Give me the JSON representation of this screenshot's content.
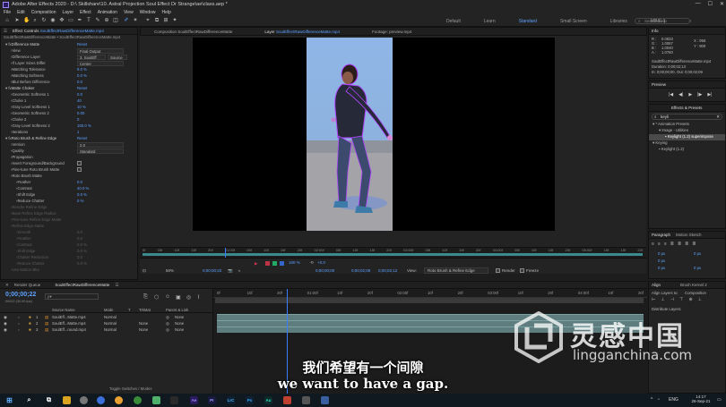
{
  "window": {
    "title": "Adobe After Effects 2020 - D:\\ Skillshare\\10. Astral Projection Soul Effect Dr Strange\\ae\\class.aep *",
    "controls": [
      "—",
      "☐",
      "✕"
    ]
  },
  "menu": [
    "File",
    "Edit",
    "Composition",
    "Layer",
    "Effect",
    "Animation",
    "View",
    "Window",
    "Help"
  ],
  "workspaces": {
    "items": [
      "Default",
      "Learn",
      "Standard",
      "Small Screen",
      "Libraries",
      "MINE 1"
    ],
    "active_index": 2,
    "overflow": "»"
  },
  "search_help": {
    "placeholder": "Search Help"
  },
  "effect_controls": {
    "tab_label": "Effect Controls",
    "tab_link": "SoulEffectRawDifferenceMatte.mp4",
    "layer_path": "SoulEffectRawDifferenceMatte • SoulEffectRawDifferenceMatte.mp4",
    "rows": [
      {
        "label": "Difference Matte",
        "value": "Reset",
        "indent": 0
      },
      {
        "label": "View",
        "value": "Final Output",
        "indent": 1,
        "select": true
      },
      {
        "label": "Difference Layer",
        "value": "3. SoulEff",
        "value2": "Source",
        "indent": 1,
        "select": true
      },
      {
        "label": "If Layer Sizes Differ",
        "value": "Center",
        "indent": 1,
        "select": true
      },
      {
        "label": "Matching Tolerance",
        "value": "9.0 %",
        "indent": 1
      },
      {
        "label": "Matching Softness",
        "value": "0.0 %",
        "indent": 1
      },
      {
        "label": "Blur Before Difference",
        "value": "0.0",
        "indent": 1
      },
      {
        "label": "Matte Choker",
        "value": "Reset",
        "indent": 0
      },
      {
        "label": "Geometric Softness 1",
        "value": "0.0",
        "indent": 1
      },
      {
        "label": "Choke 1",
        "value": "40",
        "indent": 1
      },
      {
        "label": "Gray Level Softness 1",
        "value": "10 %",
        "indent": 1
      },
      {
        "label": "Geometric Softness 2",
        "value": "0.00",
        "indent": 1
      },
      {
        "label": "Choke 2",
        "value": "0",
        "indent": 1
      },
      {
        "label": "Gray Level Softness 2",
        "value": "100.0 %",
        "indent": 1
      },
      {
        "label": "Iterations",
        "value": "1",
        "indent": 1
      },
      {
        "label": "Roto Brush & Refine Edge",
        "value": "Reset",
        "indent": 0
      },
      {
        "label": "Version",
        "value": "2.0",
        "indent": 1,
        "select": true
      },
      {
        "label": "Quality",
        "value": "Standard",
        "indent": 1,
        "select": true
      },
      {
        "label": "Propagation",
        "value": "",
        "indent": 1
      },
      {
        "label": "Invert Foreground/Background",
        "value": "",
        "indent": 1,
        "checkbox": true
      },
      {
        "label": "Fine-tune Roto Brush Matte",
        "value": "",
        "indent": 1,
        "checkbox": true
      },
      {
        "label": "Roto Brush Matte",
        "value": "",
        "indent": 1
      },
      {
        "label": "Feather",
        "value": "0.0",
        "indent": 2
      },
      {
        "label": "Contrast",
        "value": "40.0 %",
        "indent": 2
      },
      {
        "label": "Shift Edge",
        "value": "0.0 %",
        "indent": 2
      },
      {
        "label": "Reduce Chatter",
        "value": "0 %",
        "indent": 2
      },
      {
        "label": "Render Refine Edge",
        "value": "",
        "indent": 1,
        "dim": true
      },
      {
        "label": "Base Refine Edge Radius",
        "value": "",
        "indent": 1,
        "dim": true
      },
      {
        "label": "Fine-tune Refine Edge Matte",
        "value": "",
        "indent": 1,
        "dim": true
      },
      {
        "label": "Refine Edge Matte",
        "value": "",
        "indent": 1,
        "dim": true
      },
      {
        "label": "Smooth",
        "value": "0.0",
        "indent": 2,
        "dim": true
      },
      {
        "label": "Feather",
        "value": "0.0",
        "indent": 2,
        "dim": true
      },
      {
        "label": "Contrast",
        "value": "0.0 %",
        "indent": 2,
        "dim": true
      },
      {
        "label": "Shift Edge",
        "value": "0.0 %",
        "indent": 2,
        "dim": true
      },
      {
        "label": "Chatter Reduction",
        "value": "0.0",
        "indent": 2,
        "dim": true
      },
      {
        "label": "Reduce Chatter",
        "value": "0.0 %",
        "indent": 2,
        "dim": true
      },
      {
        "label": "Use Motion Blur",
        "value": "",
        "indent": 1,
        "dim": true
      }
    ]
  },
  "composition": {
    "tab_label": "Composition",
    "tab_link": "SoulEffectRawDifferenceMatte",
    "layer_tab": "Layer",
    "layer_link": "SoulEffectRawDifferenceMatte.mp4",
    "footage_tab": "Footage: preview.mp4"
  },
  "mini_ruler": {
    "ticks": [
      "0f",
      "05f",
      "10f",
      "15f",
      "20f",
      "01:00f",
      "05f",
      "10f",
      "15f",
      "20f",
      "02:00f",
      "05f",
      "10f",
      "15f",
      "20f",
      "03:00f",
      "05f",
      "10f",
      "15f",
      "20f",
      "04:00f",
      "05f",
      "10f",
      "15f",
      "20f",
      "05:00f",
      "10f",
      "15f",
      "20f"
    ]
  },
  "viewer_bar": {
    "zoom": "50%",
    "timecode": "0;00;00;22",
    "current_time": "0;00;00;00",
    "duration": "0;00;02;09",
    "end_time": "0;00;02;12",
    "view_label": "View:",
    "view_value": "Roto Brush & Refine Edge",
    "render_label": "Render",
    "freeze_label": "Freeze",
    "resolution": "100 %",
    "exposure": "+0.0"
  },
  "info": {
    "title": "Info",
    "r": "R :",
    "g": "G :",
    "b": "B :",
    "a": "A :",
    "r_val": "0.0833",
    "g_val": "1.0067",
    "b_val": "1.0040",
    "a_val": "1.0760",
    "x": "X : 956",
    "y": "Y : 900",
    "file": "SoulEffectRawDifferenceMatte.mp4",
    "duration": "Duration: 0;00;02;13",
    "in_out": "In: 0;00;00;00, Out: 0;00;02;09"
  },
  "preview": {
    "title": "Preview",
    "controls": [
      "|◀",
      "◀|",
      "▶",
      "|▶",
      "▶|"
    ]
  },
  "effects_presets": {
    "title": "Effects & Presets",
    "search_value": "keyli",
    "tree": [
      {
        "label": "* Animation Presets",
        "indent": 0
      },
      {
        "label": "Image - Utilities",
        "indent": 1
      },
      {
        "label": "Keylight (1.2) superimpose",
        "indent": 2,
        "selected": true
      },
      {
        "label": "Keying",
        "indent": 0
      },
      {
        "label": "Keylight (1.2)",
        "indent": 1
      }
    ]
  },
  "paragraph": {
    "tab": "Paragraph",
    "tab2": "Motion Sketch",
    "fields": [
      "0 px",
      "0 px",
      "0 px",
      "0 px",
      "0 px"
    ]
  },
  "align": {
    "tab": "Align",
    "tab2": "Brush Kernel 2",
    "align_to_label": "Align Layers to:",
    "align_to_value": "Composition",
    "distribute_label": "Distribute Layers:"
  },
  "timeline": {
    "tab_render": "Render Queue",
    "tab_comp": "SoulEffectRawDifferenceMatte",
    "timecode": "0;00;00;22",
    "frame_info": "00022 (30.00 fps)",
    "search_placeholder": "ρ▾",
    "col_source": "Source Name",
    "col_mode": "Mode",
    "col_t": "T",
    "col_trkmat": "TrkMat",
    "col_parent": "Parent & Link",
    "switches": "Toggle Switches / Modes",
    "ruler": [
      "0f",
      "10f",
      "20f",
      "01:00f",
      "10f",
      "20f",
      "02:00f",
      "10f",
      "20f",
      "03:00f",
      "10f",
      "20f",
      "04:00f",
      "10f",
      "20f"
    ],
    "layers": [
      {
        "num": "1",
        "name": "SoulEff...Matte.mp4",
        "mode": "Normal",
        "trkmat": "",
        "parent": "None"
      },
      {
        "num": "2",
        "name": "SoulEff...Matte.mp4",
        "mode": "Normal",
        "trkmat": "None",
        "parent": "None"
      },
      {
        "num": "3",
        "name": "SoulEff...round.mp4",
        "mode": "Normal",
        "trkmat": "None",
        "parent": "None"
      }
    ]
  },
  "subtitles": {
    "cn": "我们希望有一个间隙",
    "en": "we want to have a gap."
  },
  "watermark": {
    "title": "灵感中国",
    "url": "lingganchina.com"
  },
  "taskbar": {
    "apps": [
      "Ae",
      "Pr",
      "LrC",
      "Ps",
      "Au"
    ],
    "lang": "ENG",
    "time": "14:17",
    "date": "26-Sep-21"
  },
  "colors": {
    "accent": "#5da0ff",
    "panel": "#232323",
    "layer_bar": "#5f7d7e",
    "ruler_bar": "#3a8a8e",
    "playhead": "#3a7bff"
  }
}
